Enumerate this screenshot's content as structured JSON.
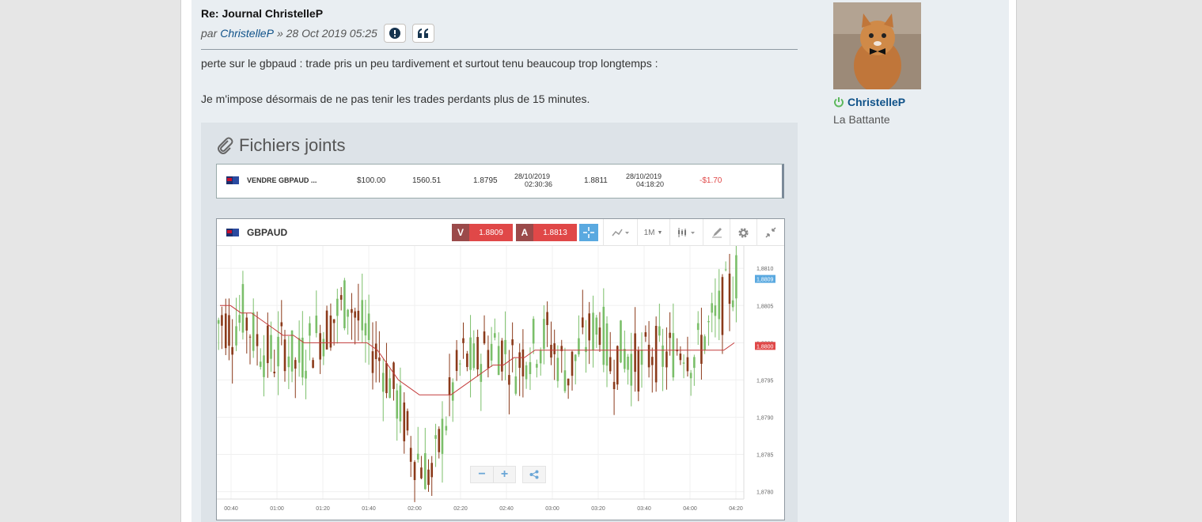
{
  "post": {
    "title": "Re: Journal ChristelleP",
    "by_prefix": "par",
    "author": "ChristelleP",
    "date": "» 28 Oct 2019 05:25",
    "report_icon": "exclamation-icon",
    "quote_icon": "quote-icon",
    "body_line1": "perte sur le gbpaud : trade pris un peu tardivement et surtout tenu beaucoup trop longtemps :",
    "body_line2": "Je m'impose désormais de ne pas tenir les trades perdants plus de 15 minutes."
  },
  "attachments": {
    "title": "Fichiers joints",
    "icon": "paperclip-icon",
    "trade_row": {
      "action": "VENDRE GBPAUD ...",
      "amount": "$100.00",
      "units": "1560.51",
      "open_rate": "1.8795",
      "open_date": "28/10/2019",
      "open_time": "02:30:36",
      "close_rate": "1.8811",
      "close_date": "28/10/2019",
      "close_time": "04:18:20",
      "pnl": "-$1.70"
    },
    "chart_window": {
      "symbol": "GBPAUD",
      "sell_label": "V",
      "sell_price": "1.8809",
      "buy_label": "A",
      "buy_price": "1.8813",
      "timeframe": "1M",
      "zoom_out": "−",
      "zoom_in": "+",
      "colors": {
        "sell": "#e04848",
        "up": "#7bbf6a",
        "down": "#8b3a1a",
        "ma": "#c43b3b",
        "last": "#5aa9e0"
      }
    }
  },
  "chart_data": {
    "type": "candlestick",
    "x_ticks": [
      "00:40",
      "01:00",
      "01:20",
      "01:40",
      "02:00",
      "02:20",
      "02:40",
      "03:00",
      "03:20",
      "03:40",
      "04:00",
      "04:20"
    ],
    "y_ticks": [
      "1,8810",
      "1,8805",
      "1,8800",
      "1,8795",
      "1,8790",
      "1,8785",
      "1,8780"
    ],
    "ylim": [
      1.8779,
      1.8813
    ],
    "last_price_label": "1,8809",
    "ma_label": "1,8800",
    "close_series": [
      1.8803,
      1.8802,
      1.8804,
      1.8801,
      1.8799,
      1.8798,
      1.88,
      1.8797,
      1.8799,
      1.8801,
      1.8802,
      1.8804,
      1.8806,
      1.8803,
      1.88,
      1.8798,
      1.8795,
      1.8791,
      1.8786,
      1.8784,
      1.8782,
      1.8788,
      1.8794,
      1.8798,
      1.8797,
      1.8799,
      1.88,
      1.8799,
      1.8797,
      1.8799,
      1.88,
      1.8801,
      1.8798,
      1.8796,
      1.8799,
      1.8801,
      1.8803,
      1.8797,
      1.8799,
      1.8798,
      1.8797,
      1.8799,
      1.8798,
      1.8799,
      1.88,
      1.8798,
      1.8801,
      1.8803,
      1.8806,
      1.8809
    ],
    "ma_series": [
      1.8805,
      1.8805,
      1.8804,
      1.8804,
      1.8803,
      1.8802,
      1.8801,
      1.8801,
      1.88,
      1.88,
      1.88,
      1.88,
      1.88,
      1.88,
      1.88,
      1.8799,
      1.8797,
      1.8795,
      1.8794,
      1.8793,
      1.8793,
      1.8793,
      1.8793,
      1.8794,
      1.8795,
      1.8796,
      1.8797,
      1.8797,
      1.8798,
      1.8798,
      1.8799,
      1.8799,
      1.8799,
      1.8799,
      1.8799,
      1.8799,
      1.8799,
      1.8799,
      1.8799,
      1.8799,
      1.8799,
      1.8799,
      1.8799,
      1.8799,
      1.8799,
      1.8799,
      1.8799,
      1.8799,
      1.8799,
      1.88
    ]
  },
  "profile": {
    "username": "ChristelleP",
    "rank": "La Battante",
    "online_icon": "power-icon",
    "avatar": "cat-avatar"
  }
}
